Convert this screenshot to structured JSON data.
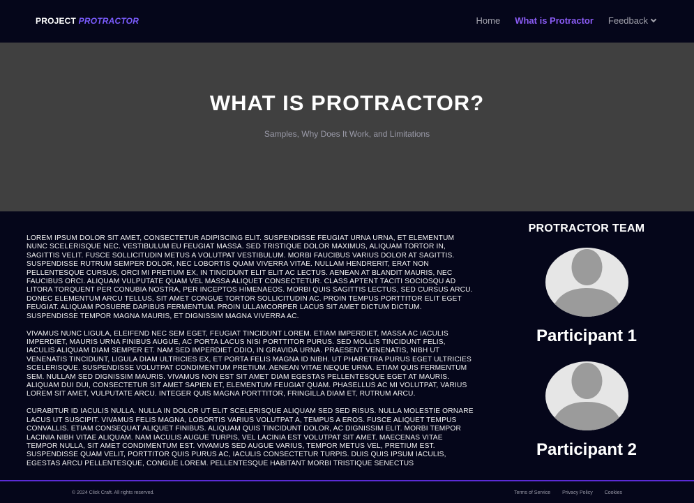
{
  "header": {
    "brand_prefix": "PROJECT",
    "brand_accent": "PROTRACTOR",
    "nav": [
      {
        "label": "Home"
      },
      {
        "label": "What is Protractor"
      },
      {
        "label": "Feedback"
      }
    ]
  },
  "hero": {
    "title": "WHAT IS PROTRACTOR?",
    "subtitle": "Samples, Why Does It Work, and Limitations"
  },
  "content": {
    "paragraphs": [
      "Lorem ipsum dolor sit amet, consectetur adipiscing elit. Suspendisse feugiat urna urna, et elementum nunc scelerisque nec. Vestibulum eu feugiat massa. Sed tristique dolor maximus, aliquam tortor in, sagittis velit. Fusce sollicitudin metus a volutpat vestibulum. Morbi faucibus varius dolor at sagittis. Suspendisse rutrum semper dolor, nec lobortis quam viverra vitae. Nullam hendrerit, erat non pellentesque cursus, orci mi pretium ex, in tincidunt elit elit ac lectus. Aenean at blandit mauris, nec faucibus orci. Aliquam vulputate quam vel massa aliquet consectetur. Class aptent taciti sociosqu ad litora torquent per conubia nostra, per inceptos himenaeos. Morbi quis sagittis lectus, sed cursus arcu. Donec elementum arcu tellus, sit amet congue tortor sollicitudin ac. Proin tempus porttitor elit eget feugiat. Aliquam posuere dapibus fermentum. Proin ullamcorper lacus sit amet dictum dictum. Suspendisse tempor magna mauris, et dignissim magna viverra ac.",
      "Vivamus nunc ligula, eleifend nec sem eget, feugiat tincidunt lorem. Etiam imperdiet, massa ac iaculis imperdiet, mauris urna finibus augue, ac porta lacus nisi porttitor purus. Sed mollis tincidunt felis, iaculis aliquam diam semper et. Nam sed imperdiet odio, in gravida urna. Praesent venenatis, nibh ut venenatis tincidunt, ligula diam ultricies ex, et porta felis magna id nibh. Ut pharetra purus eget ultricies scelerisque. Suspendisse volutpat condimentum pretium. Aenean vitae neque urna. Etiam quis fermentum sem. Nullam sed dignissim mauris. Vivamus non est sit amet diam egestas pellentesque eget at mauris. Aliquam dui dui, consectetur sit amet sapien et, elementum feugiat quam. Phasellus ac mi volutpat, varius lorem sit amet, vulputate arcu. Integer quis magna porttitor, fringilla diam et, rutrum arcu.",
      "Curabitur id iaculis nulla. Nulla in dolor ut elit scelerisque aliquam sed sed risus. Nulla molestie ornare lacus ut suscipit. Vivamus felis magna, lobortis varius volutpat a, tempus a eros. Fusce aliquet tempus convallis. Etiam consequat aliquet finibus. Aliquam quis tincidunt dolor, ac dignissim elit. Morbi tempor lacinia nibh vitae aliquam. Nam iaculis augue turpis, vel lacinia est volutpat sit amet. Maecenas vitae tempor nulla, sit amet condimentum est. Vivamus sed augue varius, tempor metus vel, pretium est. Suspendisse quam velit, porttitor quis purus ac, iaculis consectetur turpis. Duis quis ipsum iaculis, egestas arcu pellentesque, congue lorem. Pellentesque habitant morbi tristique senectus"
    ]
  },
  "sidebar": {
    "title": "PROTRACTOR TEAM",
    "participants": [
      {
        "name": "Participant 1",
        "icon": "avatar-placeholder-icon"
      },
      {
        "name": "Participant 2",
        "icon": "avatar-placeholder-icon"
      }
    ]
  },
  "footer": {
    "copyright": "© 2024 Click Craft. All rights reserved.",
    "links": [
      {
        "label": "Terms of Service"
      },
      {
        "label": "Privacy Policy"
      },
      {
        "label": "Cookies"
      }
    ]
  },
  "colors": {
    "background": "#05061a",
    "accent": "#7b5cff",
    "hero_background": "#404040",
    "footer_border": "#5b2bd6"
  }
}
